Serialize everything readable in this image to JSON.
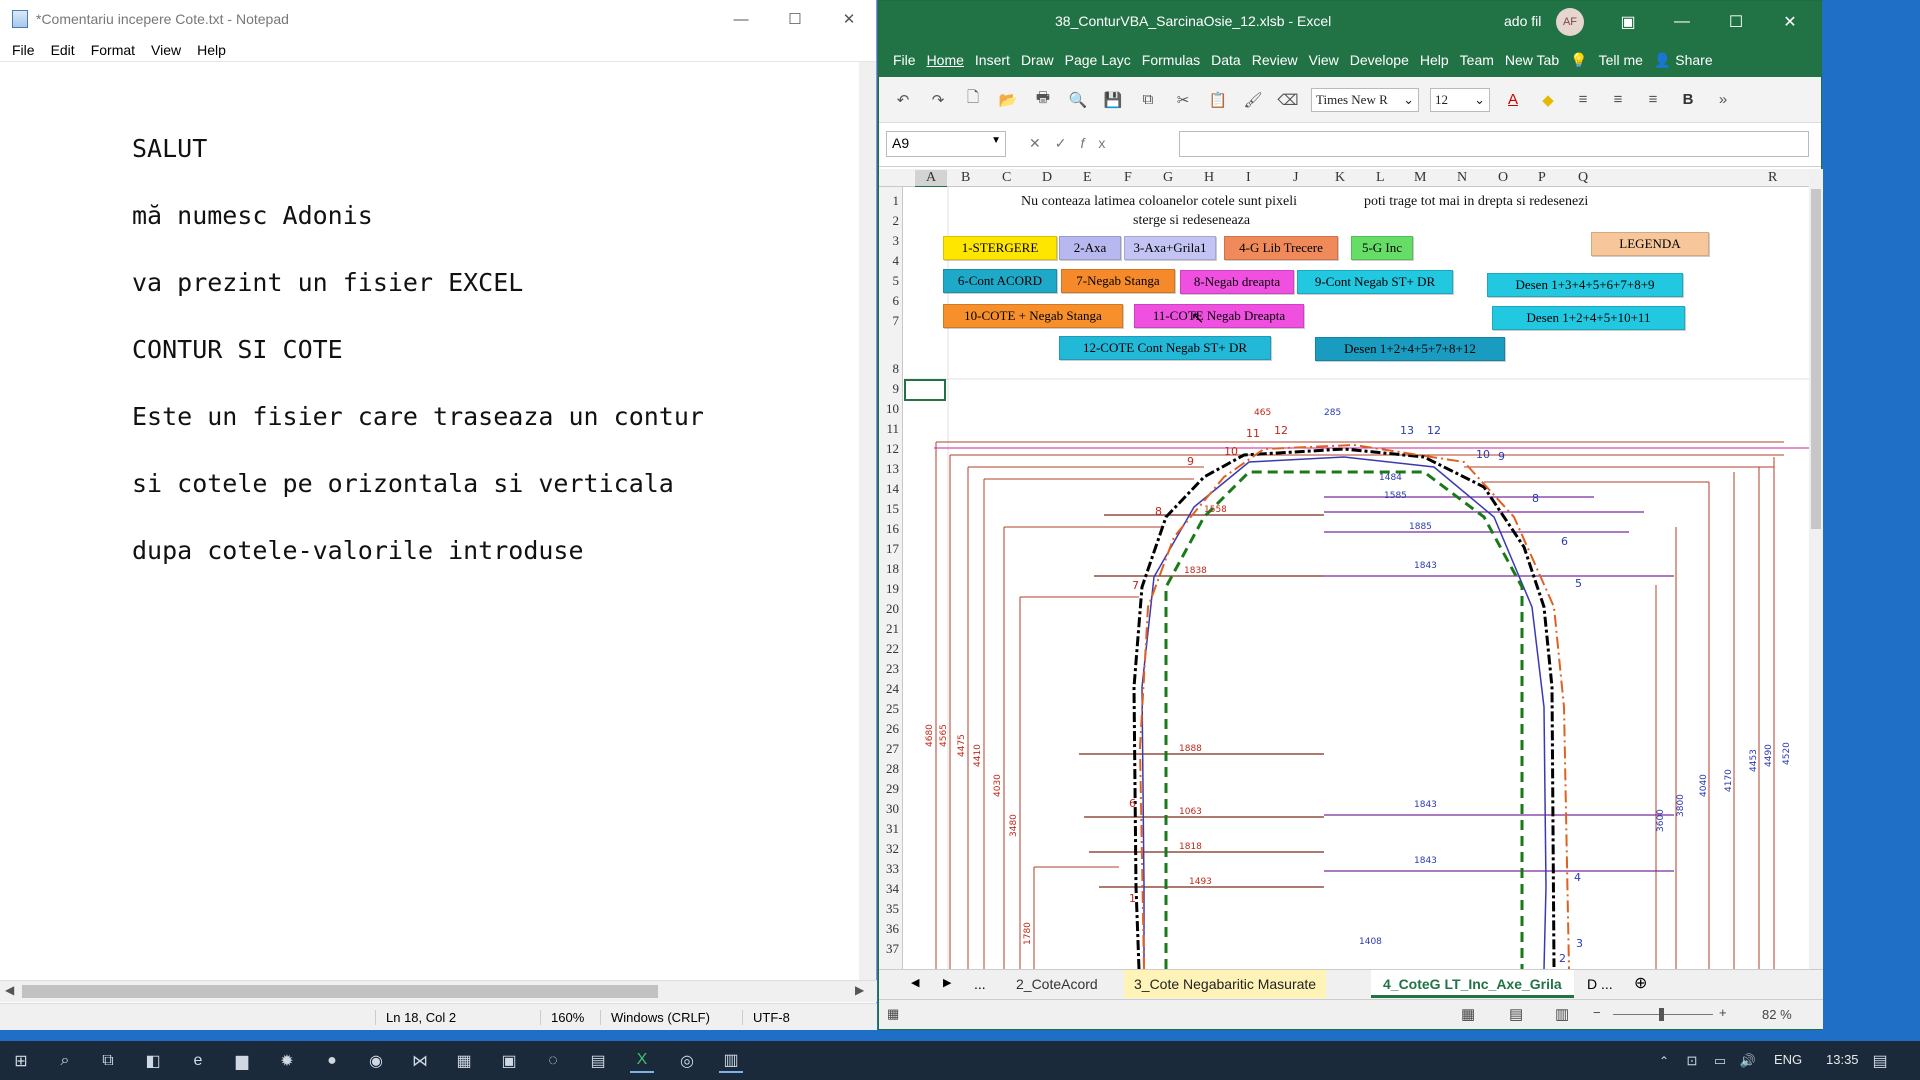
{
  "notepad": {
    "title": "*Comentariu incepere Cote.txt - Notepad",
    "menu": [
      "File",
      "Edit",
      "Format",
      "View",
      "Help"
    ],
    "lines": [
      "SALUT",
      "mă numesc Adonis",
      "va prezint un fisier EXCEL",
      "CONTUR SI COTE",
      "Este un fisier care traseaza un contur",
      "si cotele pe orizontala si verticala",
      "dupa cotele-valorile introduse"
    ],
    "status": {
      "position": "Ln 18, Col 2",
      "zoom": "160%",
      "line_ending": "Windows (CRLF)",
      "encoding": "UTF-8"
    }
  },
  "excel": {
    "title": "38_ConturVBA_SarcinaOsie_12.xlsb - Excel",
    "user": "ado fil",
    "avatar_initials": "AF",
    "ribbon_tabs": [
      "File",
      "Home",
      "Insert",
      "Draw",
      "Page Layc",
      "Formulas",
      "Data",
      "Review",
      "View",
      "Develope",
      "Help",
      "Team",
      "New Tab"
    ],
    "tell_me": "Tell me",
    "share": "Share",
    "font_name": "Times New R",
    "font_size": "12",
    "name_box": "A9",
    "columns": [
      "A",
      "B",
      "C",
      "D",
      "E",
      "F",
      "G",
      "H",
      "I",
      "J",
      "K",
      "L",
      "M",
      "N",
      "O",
      "P",
      "Q",
      "R"
    ],
    "rows": [
      "1",
      "2",
      "3",
      "4",
      "5",
      "6",
      "7",
      "8",
      "9",
      "10",
      "11",
      "12",
      "13",
      "14",
      "15",
      "16",
      "17",
      "18",
      "19",
      "20",
      "21",
      "22",
      "23",
      "24",
      "25",
      "26",
      "27",
      "28",
      "29",
      "30",
      "31",
      "32",
      "33",
      "34",
      "35",
      "36",
      "37"
    ],
    "note_1": "Nu conteaza latimea coloanelor cotele sunt pixeli",
    "note_2": "sterge si redeseneaza",
    "note_3": "poti trage tot mai in drepta si redesenezi",
    "buttons": {
      "b1": "1-STERGERE",
      "b2": "2-Axa",
      "b3": "3-Axa+Grila1",
      "b4": "4-G Lib Trecere",
      "b5": "5-G Inc",
      "b6": "6-Cont ACORD",
      "b7": "7-Negab Stanga",
      "b8": "8-Negab dreapta",
      "b9": "9-Cont Negab ST+ DR",
      "b10": "10-COTE + Negab Stanga",
      "b11": "11-COTE Negab Dreapta",
      "b12": "12-COTE Cont Negab ST+ DR",
      "legend": "LEGENDA",
      "d1": "Desen 1+3+4+5+6+7+8+9",
      "d2": "Desen 1+2+4+5+10+11",
      "d3": "Desen 1+2+4+5+7+8+12"
    },
    "colors": {
      "b1": "#ffe600",
      "b2": "#b8b8f0",
      "b3": "#c4c4f4",
      "b4": "#f08a5a",
      "b5": "#66dd66",
      "b6": "#1fa9c9",
      "b7": "#f68a2a",
      "b8": "#f050e0",
      "b9": "#22c7e0",
      "b10": "#f7902a",
      "b11": "#f050e0",
      "b12": "#22b8d8",
      "legend": "#f7c79b",
      "d1": "#22c7e0",
      "d2": "#22c7e0",
      "d3": "#1a9bc0"
    },
    "sheet_tabs": [
      "2_CoteAcord",
      "3_Cote Negabaritic Masurate",
      "4_CoteG LT_Inc_Axe_Grila"
    ],
    "sheet_tabs_overflow": "...",
    "sheet_tab_next": "D ...",
    "zoom": "82 %",
    "drawing_labels": {
      "vert_left": [
        "4680",
        "4565",
        "4475",
        "4410",
        "4030",
        "3480",
        "1780"
      ],
      "vert_right": [
        "3600",
        "3800",
        "4040",
        "4170",
        "4453",
        "4490",
        "4520"
      ],
      "horiz": [
        "1558",
        "1838",
        "1888",
        "1063",
        "1818",
        "1493",
        "1843",
        "1843",
        "1843",
        "1885",
        "1585",
        "1484",
        "285",
        "465",
        "1408"
      ],
      "points": [
        "1",
        "2",
        "3",
        "4",
        "5",
        "6",
        "7",
        "8",
        "9",
        "10",
        "11",
        "12",
        "13"
      ]
    }
  },
  "taskbar": {
    "lang": "ENG",
    "time": "13:35"
  }
}
